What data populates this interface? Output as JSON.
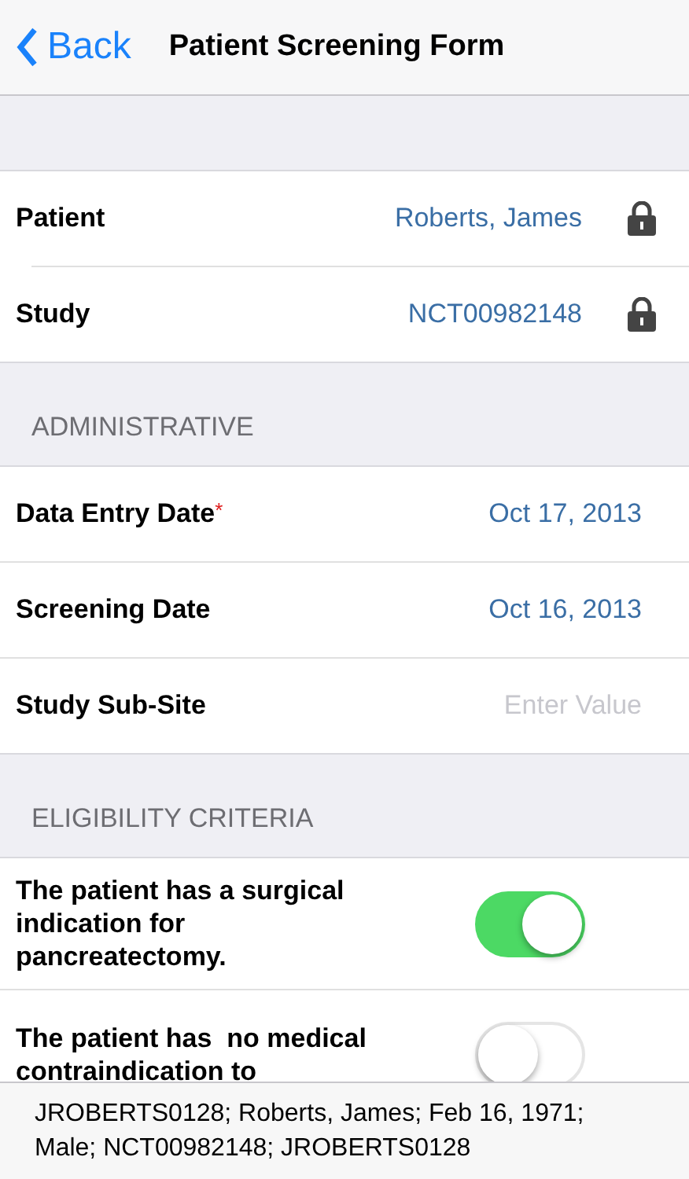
{
  "nav": {
    "back": "Back",
    "title": "Patient Screening Form"
  },
  "header_rows": [
    {
      "label": "Patient",
      "value": "Roberts, James",
      "locked": true
    },
    {
      "label": "Study",
      "value": "NCT00982148",
      "locked": true
    }
  ],
  "sections": [
    {
      "title": "ADMINISTRATIVE",
      "rows": [
        {
          "kind": "field",
          "label": "Data Entry Date",
          "required_mark": "*",
          "value": "Oct 17, 2013"
        },
        {
          "kind": "field",
          "label": "Screening Date",
          "value": "Oct 16, 2013"
        },
        {
          "kind": "field",
          "label": "Study Sub-Site",
          "placeholder": "Enter Value"
        }
      ]
    },
    {
      "title": "ELIGIBILITY CRITERIA",
      "rows": [
        {
          "kind": "toggle",
          "label": "The patient has a surgical indication for pancreatectomy.",
          "on": true
        },
        {
          "kind": "toggle",
          "label": "The patient has  no medical contraindication to",
          "on": false
        }
      ]
    }
  ],
  "footer": "JROBERTS0128; Roberts, James; Feb 16, 1971; Male; NCT00982148; JROBERTS0128"
}
